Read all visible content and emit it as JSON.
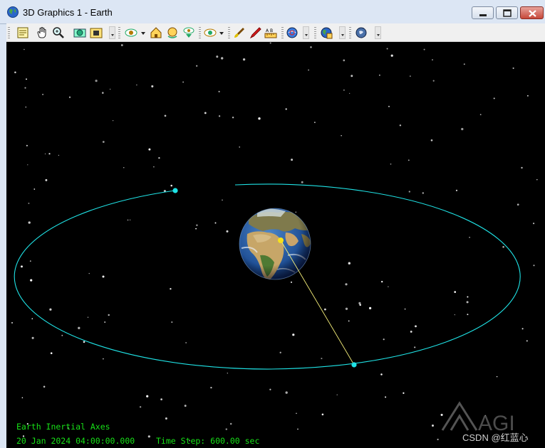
{
  "window": {
    "title": "3D Graphics 1 - Earth",
    "controls": {
      "minimize": "minimize",
      "maximize": "maximize",
      "close": "close"
    }
  },
  "toolbar": {
    "groups": [
      [
        "properties-icon",
        "pan-hand-icon",
        "zoom-icon"
      ],
      [
        "map-snapshot-icon",
        "record-camera-icon"
      ],
      [
        "view-from-eye-icon",
        "home-view-icon",
        "home-orbit-icon",
        "view-down-icon"
      ],
      [
        "orbit-view-icon"
      ],
      [
        "brush-icon",
        "pen-icon",
        "ruler-icon"
      ],
      [
        "globe-tool-icon"
      ],
      [
        "earth-data-icon"
      ],
      [
        "earth-camera-icon"
      ]
    ]
  },
  "overlay": {
    "axes_label": "Earth Inertial Axes",
    "datetime": "20 Jan 2024 04:00:00.000",
    "time_step": "Time Step: 600.00 sec"
  },
  "watermark": {
    "logo": "AGI",
    "credit": "CSDN @红蓝心"
  },
  "colors": {
    "orbit": "#1fe3e6",
    "sat_line": "#f7f17a",
    "overlay_text": "#17e017",
    "background": "#000000"
  }
}
